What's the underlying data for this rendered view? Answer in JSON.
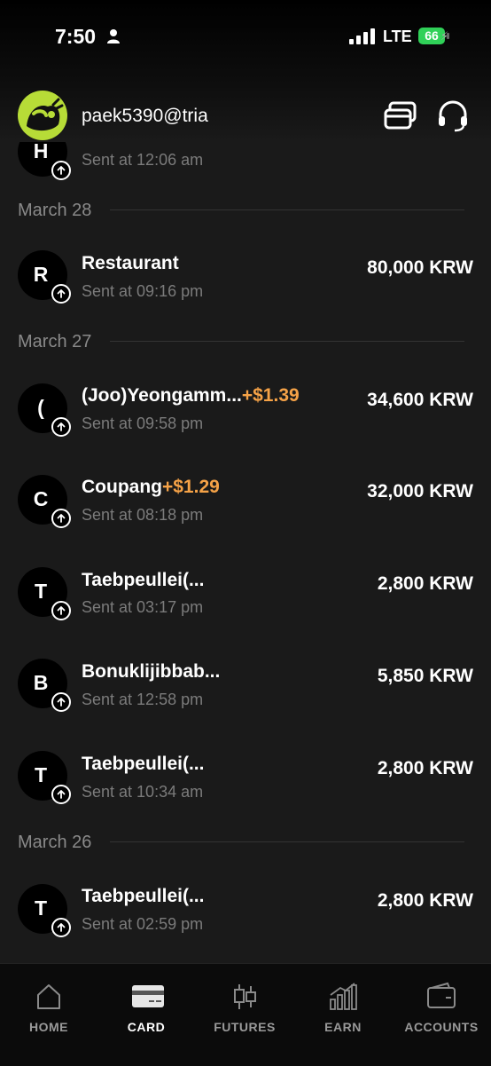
{
  "status": {
    "time": "7:50",
    "network": "LTE",
    "battery": "66"
  },
  "header": {
    "username": "paek5390@tria"
  },
  "top_partial": {
    "letter": "H",
    "time": "Sent at 12:06 am"
  },
  "groups": [
    {
      "date": "March 28",
      "items": [
        {
          "letter": "R",
          "merchant": "Restaurant",
          "cashback": "",
          "time": "Sent at 09:16 pm",
          "amount": "80,000 KRW"
        }
      ]
    },
    {
      "date": "March 27",
      "items": [
        {
          "letter": "(",
          "merchant": "(Joo)Yeongamm...",
          "cashback": "+$1.39",
          "time": "Sent at 09:58 pm",
          "amount": "34,600 KRW"
        },
        {
          "letter": "C",
          "merchant": "Coupang",
          "cashback": "+$1.29",
          "time": "Sent at 08:18 pm",
          "amount": "32,000 KRW"
        },
        {
          "letter": "T",
          "merchant": "Taebpeullei(...",
          "cashback": "",
          "time": "Sent at 03:17 pm",
          "amount": "2,800 KRW"
        },
        {
          "letter": "B",
          "merchant": "Bonuklijibbab...",
          "cashback": "",
          "time": "Sent at 12:58 pm",
          "amount": "5,850 KRW"
        },
        {
          "letter": "T",
          "merchant": "Taebpeullei(...",
          "cashback": "",
          "time": "Sent at 10:34 am",
          "amount": "2,800 KRW"
        }
      ]
    },
    {
      "date": "March 26",
      "items": [
        {
          "letter": "T",
          "merchant": "Taebpeullei(...",
          "cashback": "",
          "time": "Sent at 02:59 pm",
          "amount": "2,800 KRW"
        }
      ]
    }
  ],
  "nav": [
    {
      "label": "HOME",
      "icon": "home-icon",
      "active": false
    },
    {
      "label": "CARD",
      "icon": "card-icon",
      "active": true
    },
    {
      "label": "FUTURES",
      "icon": "candlestick-icon",
      "active": false
    },
    {
      "label": "EARN",
      "icon": "bar-chart-icon",
      "active": false
    },
    {
      "label": "ACCOUNTS",
      "icon": "wallet-icon",
      "active": false
    }
  ]
}
